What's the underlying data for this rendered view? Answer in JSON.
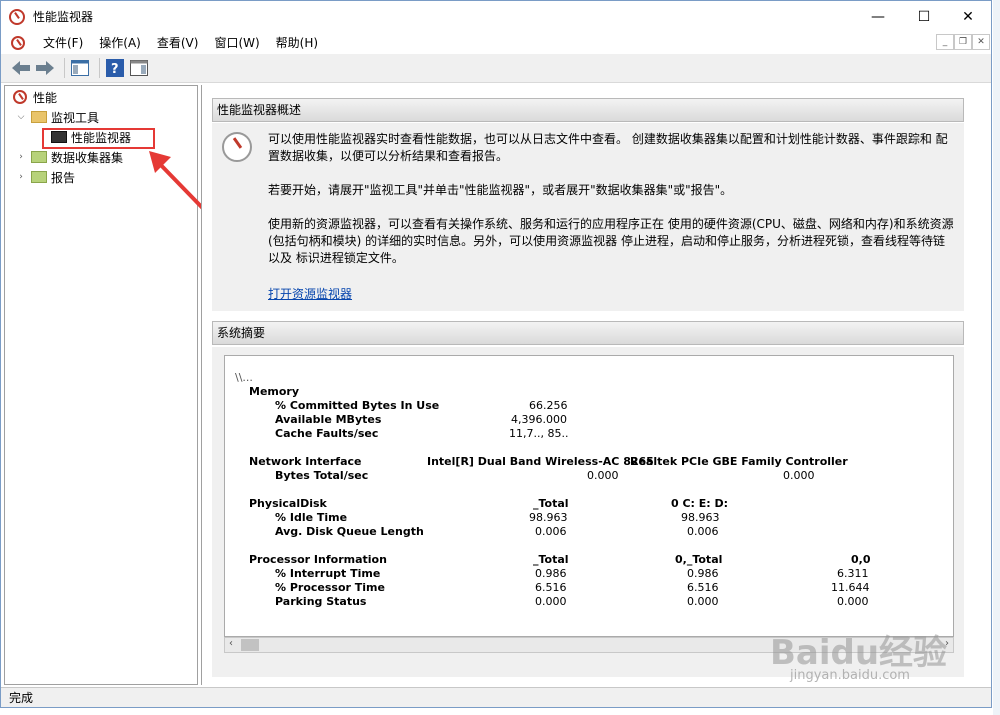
{
  "window": {
    "title": "性能监视器",
    "min": "—",
    "max": "☐",
    "close": "✕"
  },
  "menu": [
    "文件(F)",
    "操作(A)",
    "查看(V)",
    "窗口(W)",
    "帮助(H)"
  ],
  "tree": {
    "root": "性能",
    "monitor_tools": "监视工具",
    "perf_monitor": "性能监视器",
    "collector_sets": "数据收集器集",
    "reports": "报告"
  },
  "overview": {
    "header": "性能监视器概述",
    "p1a": "可以使用性能监视器实时查看性能数据，也可以从日志文件中查看。 创建数据收集器集以配置和计划性能计数器、事件跟踪和 配",
    "p1b": "置数据收集，以便可以分析结果和查看报告。",
    "p2": "若要开始，请展开\"监视工具\"并单击\"性能监视器\"，或者展开\"数据收集器集\"或\"报告\"。",
    "p3a": "使用新的资源监视器，可以查看有关操作系统、服务和运行的应用程序正在 使用的硬件资源(CPU、磁盘、网络和内存)和系统资源",
    "p3b": "(包括句柄和模块) 的详细的实时信息。另外，可以使用资源监视器 停止进程，启动和停止服务，分析进程死锁，查看线程等待链",
    "p3c": "以及 标识进程锁定文件。",
    "link": "打开资源监视器"
  },
  "summary": {
    "header": "系统摘要",
    "host": "\\\\...",
    "memory": {
      "title": "Memory",
      "rows": [
        {
          "label": "% Committed Bytes In Use",
          "value": "66.256"
        },
        {
          "label": "Available MBytes",
          "value": "4,396.000"
        },
        {
          "label": "Cache Faults/sec",
          "value": "11,7.., 85.."
        }
      ]
    },
    "network": {
      "title": "Network Interface",
      "col1": "Intel[R] Dual Band Wireless-AC 8265",
      "col2": "Realtek PCIe GBE Family Controller",
      "row_label": "Bytes Total/sec",
      "v1": "0.000",
      "v2": "0.000"
    },
    "disk": {
      "title": "PhysicalDisk",
      "col1": "_Total",
      "col2": "0 C: E: D:",
      "rows": [
        {
          "label": "% Idle Time",
          "v1": "98.963",
          "v2": "98.963"
        },
        {
          "label": "Avg. Disk Queue Length",
          "v1": "0.006",
          "v2": "0.006"
        }
      ]
    },
    "processor": {
      "title": "Processor Information",
      "col1": "_Total",
      "col2": "0,_Total",
      "col3": "0,0",
      "rows": [
        {
          "label": "% Interrupt Time",
          "v1": "0.986",
          "v2": "0.986",
          "v3": "6.311"
        },
        {
          "label": "% Processor Time",
          "v1": "6.516",
          "v2": "6.516",
          "v3": "11.644"
        },
        {
          "label": "Parking Status",
          "v1": "0.000",
          "v2": "0.000",
          "v3": "0.000"
        }
      ]
    }
  },
  "status": "完成",
  "watermark": {
    "main": "Baidu经验",
    "sub": "jingyan.baidu.com"
  },
  "colors": {
    "highlight": "#e53935",
    "link": "#0645ad"
  }
}
